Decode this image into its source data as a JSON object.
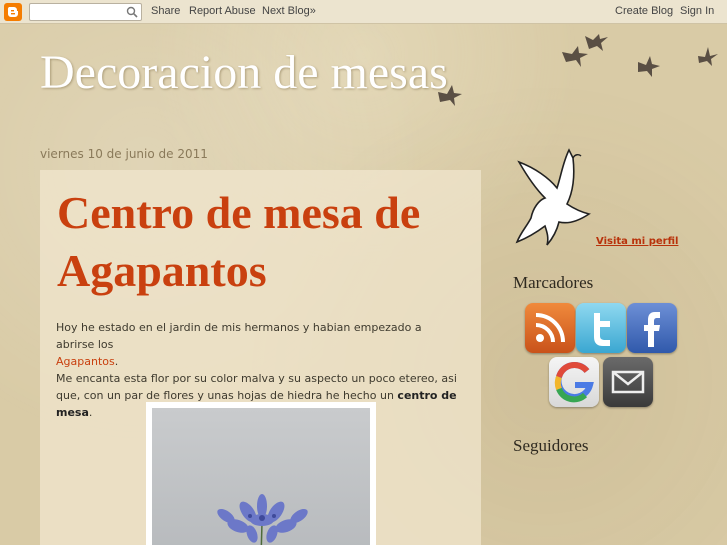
{
  "navbar": {
    "share": "Share",
    "report_abuse": "Report Abuse",
    "next_blog": "Next Blog»",
    "create_blog": "Create Blog",
    "sign_in": "Sign In"
  },
  "header": {
    "title": "Decoracion de mesas"
  },
  "post": {
    "date": "viernes 10 de junio de 2011",
    "title": "Centro de mesa de Agapantos",
    "p1": "Hoy he estado en el jardin de mis hermanos y habian empezado a abrirse los",
    "p1_link": "Agapantos",
    "p1_end": ".",
    "p2": "Me encanta esta flor por su color malva y su aspecto un poco etereo, asi que, con un par de flores y unas hojas de hiedra he hecho un",
    "p2_bold": "centro de mesa",
    "p2_end": "."
  },
  "sidebar": {
    "profile_link": "Visita mi perfil",
    "bookmarks_heading": "Marcadores",
    "followers_heading": "Seguidores",
    "icons": [
      "rss-icon",
      "twitter-icon",
      "facebook-icon",
      "google-icon",
      "email-icon"
    ]
  },
  "colors": {
    "accent": "#c9400f",
    "background": "#d9cba6",
    "title_text": "#ffffff",
    "blogger_orange": "#f57d00"
  }
}
